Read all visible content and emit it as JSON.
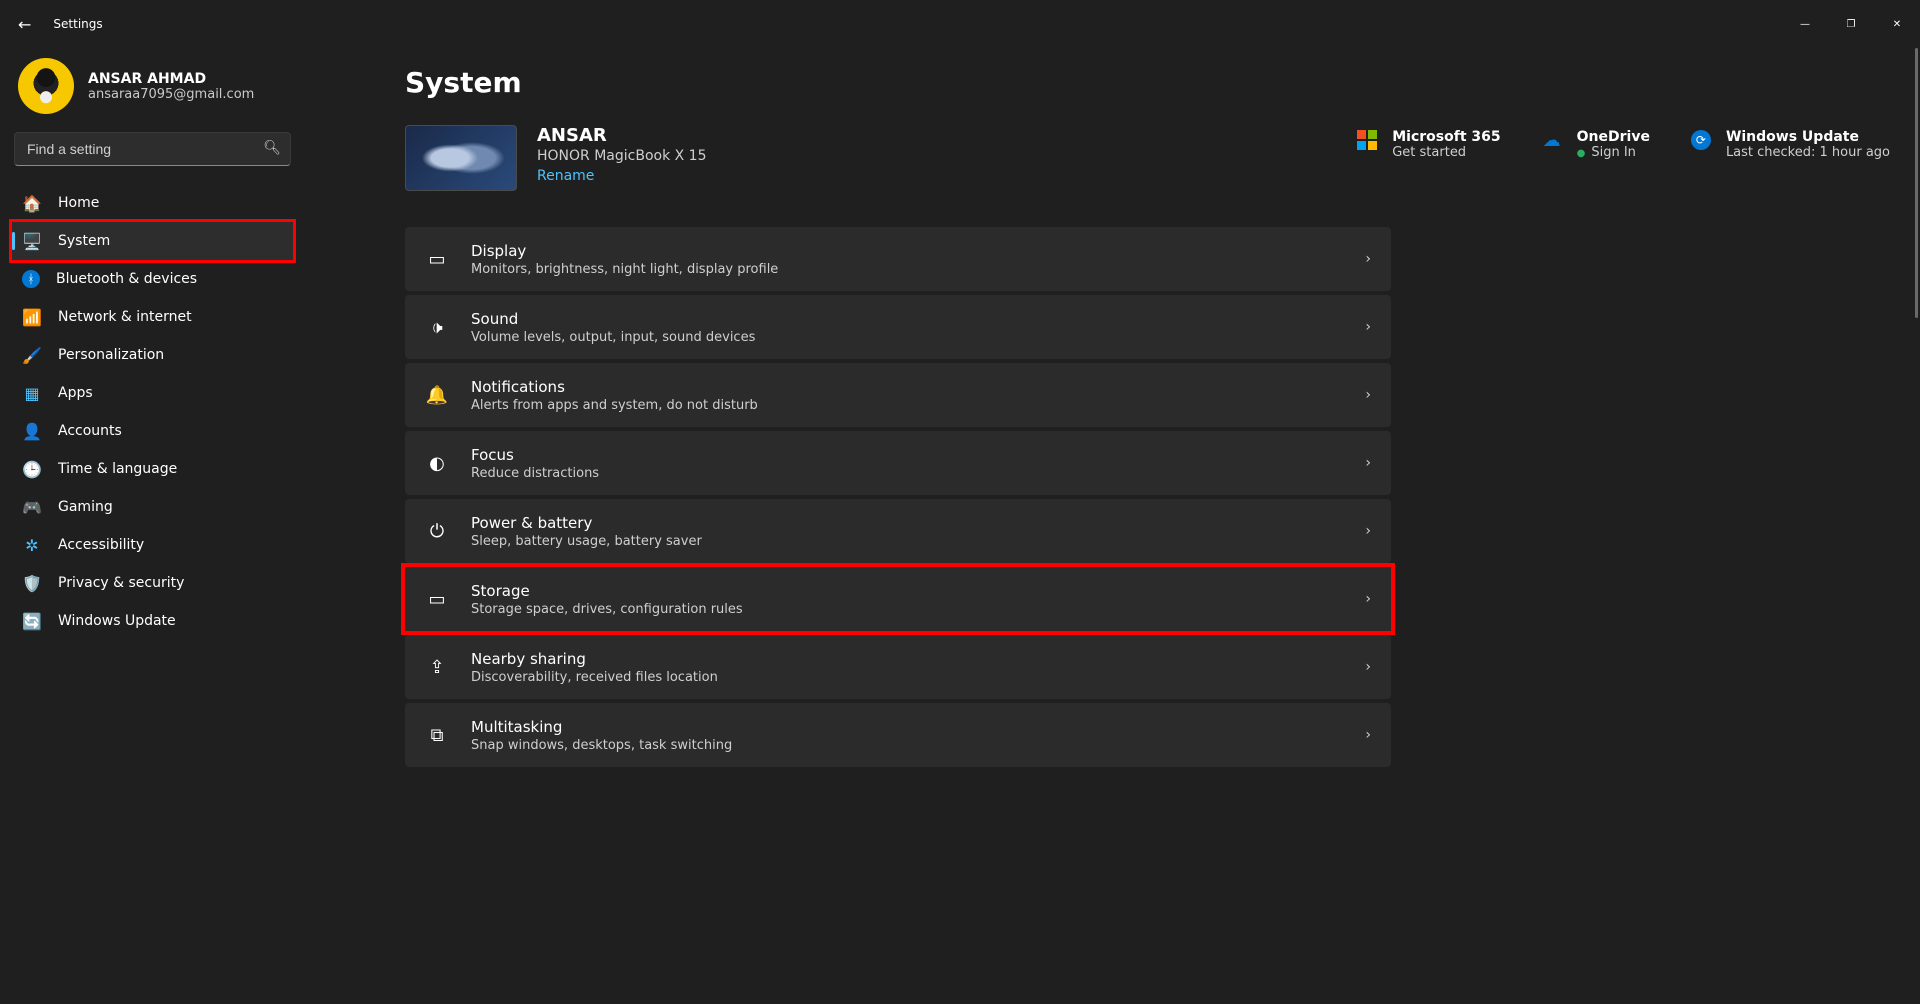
{
  "app_title": "Settings",
  "window_controls": {
    "minimize": "—",
    "maximize": "❐",
    "close": "✕"
  },
  "user": {
    "name": "ANSAR AHMAD",
    "email": "ansaraa7095@gmail.com"
  },
  "search": {
    "placeholder": "Find a setting"
  },
  "nav": [
    {
      "icon": "🏠",
      "label": "Home",
      "name": "home"
    },
    {
      "icon": "🖥️",
      "label": "System",
      "name": "system",
      "active": true,
      "highlighted": true
    },
    {
      "icon": "ᚼ",
      "label": "Bluetooth & devices",
      "name": "bluetooth",
      "icon_bg": "#0078d4"
    },
    {
      "icon": "📶",
      "label": "Network & internet",
      "name": "network",
      "icon_color": "#4cc2ff"
    },
    {
      "icon": "🖌️",
      "label": "Personalization",
      "name": "personalization"
    },
    {
      "icon": "▦",
      "label": "Apps",
      "name": "apps",
      "icon_color": "#4cc2ff"
    },
    {
      "icon": "👤",
      "label": "Accounts",
      "name": "accounts"
    },
    {
      "icon": "🕒",
      "label": "Time & language",
      "name": "time"
    },
    {
      "icon": "🎮",
      "label": "Gaming",
      "name": "gaming"
    },
    {
      "icon": "✲",
      "label": "Accessibility",
      "name": "accessibility",
      "icon_color": "#4cc2ff"
    },
    {
      "icon": "🛡️",
      "label": "Privacy & security",
      "name": "privacy"
    },
    {
      "icon": "🔄",
      "label": "Windows Update",
      "name": "update",
      "icon_color": "#0078d4"
    }
  ],
  "page": {
    "title": "System",
    "pc": {
      "name": "ANSAR",
      "model": "HONOR MagicBook X 15",
      "rename": "Rename"
    },
    "promos": {
      "ms365": {
        "title": "Microsoft 365",
        "sub": "Get started"
      },
      "onedrive": {
        "title": "OneDrive",
        "sub": "Sign In"
      },
      "winupdate": {
        "title": "Windows Update",
        "sub": "Last checked: 1 hour ago"
      }
    },
    "items": [
      {
        "icon": "▭",
        "title": "Display",
        "sub": "Monitors, brightness, night light, display profile",
        "name": "display"
      },
      {
        "icon": "🕩",
        "title": "Sound",
        "sub": "Volume levels, output, input, sound devices",
        "name": "sound"
      },
      {
        "icon": "🔔",
        "title": "Notifications",
        "sub": "Alerts from apps and system, do not disturb",
        "name": "notifications"
      },
      {
        "icon": "◐",
        "title": "Focus",
        "sub": "Reduce distractions",
        "name": "focus"
      },
      {
        "icon": "⏻",
        "title": "Power & battery",
        "sub": "Sleep, battery usage, battery saver",
        "name": "power"
      },
      {
        "icon": "▭",
        "title": "Storage",
        "sub": "Storage space, drives, configuration rules",
        "name": "storage",
        "highlighted": true
      },
      {
        "icon": "⇪",
        "title": "Nearby sharing",
        "sub": "Discoverability, received files location",
        "name": "nearby"
      },
      {
        "icon": "⧉",
        "title": "Multitasking",
        "sub": "Snap windows, desktops, task switching",
        "name": "multitasking"
      }
    ]
  }
}
